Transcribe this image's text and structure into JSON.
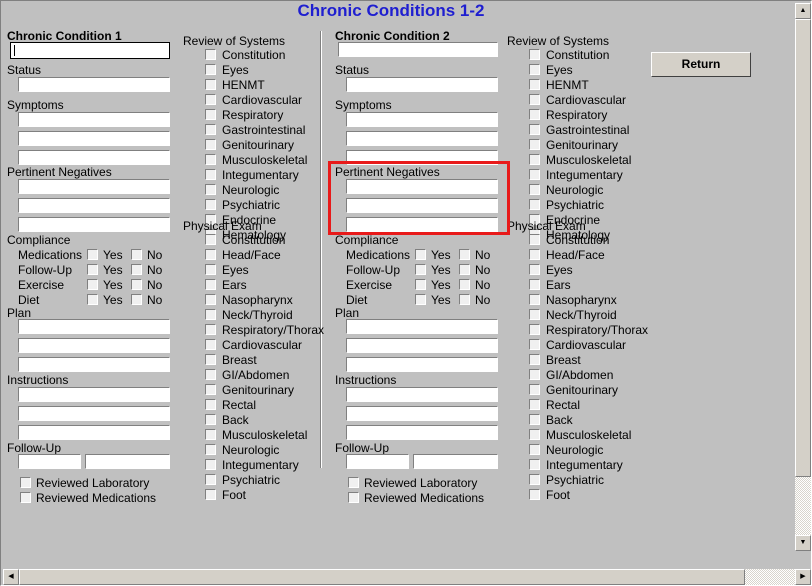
{
  "window": {
    "title": "Chronic Conditions 1-2",
    "title_color": "#1f1fd0",
    "background_color": "#c0c0c0",
    "highlight_color": "#e81a1a"
  },
  "toolbar": {
    "return_label": "Return"
  },
  "condition1": {
    "heading": "Chronic Condition 1",
    "name_value": "",
    "status_label": "Status",
    "status_value": "",
    "symptoms_label": "Symptoms",
    "symptoms_values": [
      "",
      "",
      ""
    ],
    "pertinent_negatives_label": "Pertinent Negatives",
    "pertinent_negatives_values": [
      "",
      "",
      ""
    ],
    "compliance_label": "Compliance",
    "compliance_rows": [
      {
        "label": "Medications",
        "yes": "Yes",
        "no": "No",
        "yes_checked": false,
        "no_checked": false
      },
      {
        "label": "Follow-Up",
        "yes": "Yes",
        "no": "No",
        "yes_checked": false,
        "no_checked": false
      },
      {
        "label": "Exercise",
        "yes": "Yes",
        "no": "No",
        "yes_checked": false,
        "no_checked": false
      },
      {
        "label": "Diet",
        "yes": "Yes",
        "no": "No",
        "yes_checked": false,
        "no_checked": false
      }
    ],
    "plan_label": "Plan",
    "plan_values": [
      "",
      "",
      ""
    ],
    "instructions_label": "Instructions",
    "instructions_values": [
      "",
      "",
      ""
    ],
    "followup_label": "Follow-Up",
    "followup_values": [
      "",
      ""
    ],
    "reviewed": [
      {
        "label": "Reviewed Laboratory",
        "checked": false
      },
      {
        "label": "Reviewed Medications",
        "checked": false
      }
    ]
  },
  "condition2": {
    "heading": "Chronic Condition 2",
    "name_value": "",
    "status_label": "Status",
    "status_value": "",
    "symptoms_label": "Symptoms",
    "symptoms_values": [
      "",
      "",
      ""
    ],
    "pertinent_negatives_label": "Pertinent Negatives",
    "pertinent_negatives_values": [
      "",
      "",
      ""
    ],
    "compliance_label": "Compliance",
    "compliance_rows": [
      {
        "label": "Medications",
        "yes": "Yes",
        "no": "No",
        "yes_checked": false,
        "no_checked": false
      },
      {
        "label": "Follow-Up",
        "yes": "Yes",
        "no": "No",
        "yes_checked": false,
        "no_checked": false
      },
      {
        "label": "Exercise",
        "yes": "Yes",
        "no": "No",
        "yes_checked": false,
        "no_checked": false
      },
      {
        "label": "Diet",
        "yes": "Yes",
        "no": "No",
        "yes_checked": false,
        "no_checked": false
      }
    ],
    "plan_label": "Plan",
    "plan_values": [
      "",
      "",
      ""
    ],
    "instructions_label": "Instructions",
    "instructions_values": [
      "",
      "",
      ""
    ],
    "followup_label": "Follow-Up",
    "followup_values": [
      "",
      ""
    ],
    "reviewed": [
      {
        "label": "Reviewed Laboratory",
        "checked": false
      },
      {
        "label": "Reviewed Medications",
        "checked": false
      }
    ]
  },
  "ros1": {
    "heading": "Review of Systems",
    "items": [
      {
        "label": "Constitution",
        "checked": false
      },
      {
        "label": "Eyes",
        "checked": false
      },
      {
        "label": "HENMT",
        "checked": false
      },
      {
        "label": "Cardiovascular",
        "checked": false
      },
      {
        "label": "Respiratory",
        "checked": false
      },
      {
        "label": "Gastrointestinal",
        "checked": false
      },
      {
        "label": "Genitourinary",
        "checked": false
      },
      {
        "label": "Musculoskeletal",
        "checked": false
      },
      {
        "label": "Integumentary",
        "checked": false
      },
      {
        "label": "Neurologic",
        "checked": false
      },
      {
        "label": "Psychiatric",
        "checked": false
      },
      {
        "label": "Endocrine",
        "checked": false
      },
      {
        "label": "Hematology",
        "checked": false
      }
    ]
  },
  "pe1": {
    "heading": "Physical Exam",
    "items": [
      {
        "label": "Constitution",
        "checked": false
      },
      {
        "label": "Head/Face",
        "checked": false
      },
      {
        "label": "Eyes",
        "checked": false
      },
      {
        "label": "Ears",
        "checked": false
      },
      {
        "label": "Nasopharynx",
        "checked": false
      },
      {
        "label": "Neck/Thyroid",
        "checked": false
      },
      {
        "label": "Respiratory/Thorax",
        "checked": false
      },
      {
        "label": "Cardiovascular",
        "checked": false
      },
      {
        "label": "Breast",
        "checked": false
      },
      {
        "label": "GI/Abdomen",
        "checked": false
      },
      {
        "label": "Genitourinary",
        "checked": false
      },
      {
        "label": "Rectal",
        "checked": false
      },
      {
        "label": "Back",
        "checked": false
      },
      {
        "label": "Musculoskeletal",
        "checked": false
      },
      {
        "label": "Neurologic",
        "checked": false
      },
      {
        "label": "Integumentary",
        "checked": false
      },
      {
        "label": "Psychiatric",
        "checked": false
      },
      {
        "label": "Foot",
        "checked": false
      }
    ]
  },
  "ros2": {
    "heading": "Review of Systems",
    "items": [
      {
        "label": "Constitution",
        "checked": false
      },
      {
        "label": "Eyes",
        "checked": false
      },
      {
        "label": "HENMT",
        "checked": false
      },
      {
        "label": "Cardiovascular",
        "checked": false
      },
      {
        "label": "Respiratory",
        "checked": false
      },
      {
        "label": "Gastrointestinal",
        "checked": false
      },
      {
        "label": "Genitourinary",
        "checked": false
      },
      {
        "label": "Musculoskeletal",
        "checked": false
      },
      {
        "label": "Integumentary",
        "checked": false
      },
      {
        "label": "Neurologic",
        "checked": false
      },
      {
        "label": "Psychiatric",
        "checked": false
      },
      {
        "label": "Endocrine",
        "checked": false
      },
      {
        "label": "Hematology",
        "checked": false
      }
    ]
  },
  "pe2": {
    "heading": "Physical Exam",
    "items": [
      {
        "label": "Constitution",
        "checked": false
      },
      {
        "label": "Head/Face",
        "checked": false
      },
      {
        "label": "Eyes",
        "checked": false
      },
      {
        "label": "Ears",
        "checked": false
      },
      {
        "label": "Nasopharynx",
        "checked": false
      },
      {
        "label": "Neck/Thyroid",
        "checked": false
      },
      {
        "label": "Respiratory/Thorax",
        "checked": false
      },
      {
        "label": "Cardiovascular",
        "checked": false
      },
      {
        "label": "Breast",
        "checked": false
      },
      {
        "label": "GI/Abdomen",
        "checked": false
      },
      {
        "label": "Genitourinary",
        "checked": false
      },
      {
        "label": "Rectal",
        "checked": false
      },
      {
        "label": "Back",
        "checked": false
      },
      {
        "label": "Musculoskeletal",
        "checked": false
      },
      {
        "label": "Neurologic",
        "checked": false
      },
      {
        "label": "Integumentary",
        "checked": false
      },
      {
        "label": "Psychiatric",
        "checked": false
      },
      {
        "label": "Foot",
        "checked": false
      }
    ]
  },
  "scrollbars": {
    "vertical": {
      "up_arrow": "▲",
      "down_arrow": "▼"
    },
    "horizontal": {
      "left_arrow": "◀",
      "right_arrow": "▶"
    }
  }
}
